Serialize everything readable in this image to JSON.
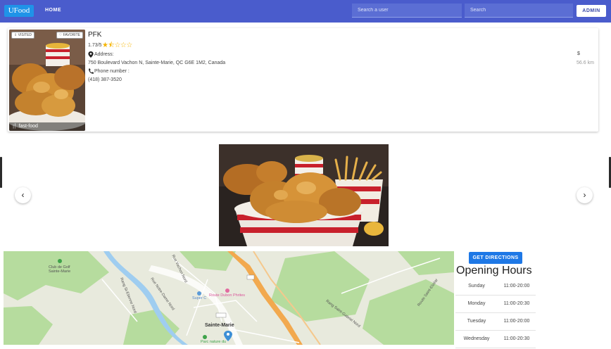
{
  "header": {
    "logo": "UFood",
    "nav_home": "HOME",
    "search_user_placeholder": "Search a user",
    "search_placeholder": "Search",
    "admin_label": "ADMIN"
  },
  "restaurant": {
    "visited_label": "VISITED",
    "favorite_label": "FAVORITE",
    "category": "fast-food",
    "name": "PFK",
    "rating_text": "1.73/5",
    "rating_value": 1.73,
    "rating_max": 5,
    "address_label": "Address:",
    "address": "750 Boulevard Vachon N, Sainte-Marie, QC G6E 1M2, Canada",
    "phone_label": "Phone number :",
    "phone": "(418) 387-3520",
    "price": "$",
    "distance": "56.6 km"
  },
  "map": {
    "labels": [
      "Club de Golf Sainte-Marie",
      "Rang St-Etienne Nord",
      "Rue Notre-Dame Nord",
      "Rue Vachon Nord",
      "Super C",
      "Sainte-Marie",
      "Parc nature du",
      "Rang Saint-Gabriel Nord",
      "Route Saint-Elzéar",
      "Route Dubon Phrites"
    ],
    "colors": {
      "land": "#e8eadd",
      "green": "#b6dc9e",
      "water": "#9fcdf0",
      "highway": "#f2a94e"
    }
  },
  "hours": {
    "directions_label": "GET DIRECTIONS",
    "title": "Opening Hours",
    "rows": [
      {
        "day": "Sunday",
        "time": "11:00-20:00"
      },
      {
        "day": "Monday",
        "time": "11:00-20:30"
      },
      {
        "day": "Tuesday",
        "time": "11:00-20:00"
      },
      {
        "day": "Wednesday",
        "time": "11:00-20:30"
      }
    ]
  },
  "colors": {
    "header": "#4a5ccc",
    "logo_bg": "#1f93e8",
    "directions": "#1e78e6",
    "star": "#f5b400"
  }
}
